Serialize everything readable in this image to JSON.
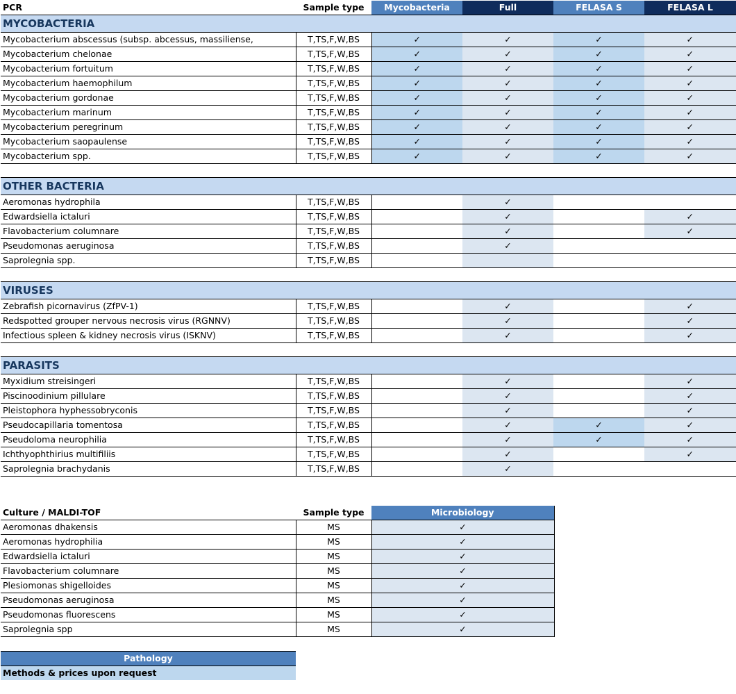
{
  "check_mark": "✓",
  "pcr": {
    "header": {
      "title": "PCR",
      "sample_type": "Sample type",
      "columns": [
        "Mycobacteria",
        "Full",
        "FELASA S",
        "FELASA L"
      ]
    },
    "sections": [
      {
        "title": "MYCOBACTERIA",
        "rows": [
          {
            "name": "Mycobacterium abscessus (subsp. abcessus, massiliense,",
            "sample": "T,TS,F,W,BS",
            "checks": [
              true,
              true,
              true,
              true
            ]
          },
          {
            "name": "Mycobacterium chelonae",
            "sample": "T,TS,F,W,BS",
            "checks": [
              true,
              true,
              true,
              true
            ]
          },
          {
            "name": "Mycobacterium fortuitum",
            "sample": "T,TS,F,W,BS",
            "checks": [
              true,
              true,
              true,
              true
            ]
          },
          {
            "name": "Mycobacterium haemophilum",
            "sample": "T,TS,F,W,BS",
            "checks": [
              true,
              true,
              true,
              true
            ]
          },
          {
            "name": "Mycobacterium gordonae",
            "sample": "T,TS,F,W,BS",
            "checks": [
              true,
              true,
              true,
              true
            ]
          },
          {
            "name": "Mycobacterium marinum",
            "sample": "T,TS,F,W,BS",
            "checks": [
              true,
              true,
              true,
              true
            ]
          },
          {
            "name": "Mycobacterium peregrinum",
            "sample": "T,TS,F,W,BS",
            "checks": [
              true,
              true,
              true,
              true
            ]
          },
          {
            "name": "Mycobacterium saopaulense",
            "sample": "T,TS,F,W,BS",
            "checks": [
              true,
              true,
              true,
              true
            ]
          },
          {
            "name": "Mycobacterium spp.",
            "sample": "T,TS,F,W,BS",
            "checks": [
              true,
              true,
              true,
              true
            ]
          }
        ]
      },
      {
        "title": "OTHER BACTERIA",
        "rows": [
          {
            "name": "Aeromonas hydrophila",
            "sample": "T,TS,F,W,BS",
            "checks": [
              false,
              true,
              false,
              false
            ]
          },
          {
            "name": "Edwardsiella ictaluri",
            "sample": "T,TS,F,W,BS",
            "checks": [
              false,
              true,
              false,
              true
            ]
          },
          {
            "name": "Flavobacterium columnare",
            "sample": "T,TS,F,W,BS",
            "checks": [
              false,
              true,
              false,
              true
            ]
          },
          {
            "name": "Pseudomonas aeruginosa",
            "sample": "T,TS,F,W,BS",
            "checks": [
              false,
              true,
              false,
              false
            ]
          },
          {
            "name": "Saprolegnia spp.",
            "sample": "T,TS,F,W,BS",
            "checks": [
              false,
              false,
              false,
              false
            ]
          }
        ]
      },
      {
        "title": "VIRUSES",
        "rows": [
          {
            "name": "Zebrafish picornavirus (ZfPV-1)",
            "sample": "T,TS,F,W,BS",
            "checks": [
              false,
              true,
              false,
              true
            ]
          },
          {
            "name": "Redspotted grouper nervous necrosis virus (RGNNV)",
            "sample": "T,TS,F,W,BS",
            "checks": [
              false,
              true,
              false,
              true
            ]
          },
          {
            "name": "Infectious spleen & kidney necrosis virus (ISKNV)",
            "sample": "T,TS,F,W,BS",
            "checks": [
              false,
              true,
              false,
              true
            ]
          }
        ]
      },
      {
        "title": "PARASITS",
        "rows": [
          {
            "name": "Myxidium streisingeri",
            "sample": "T,TS,F,W,BS",
            "checks": [
              false,
              true,
              false,
              true
            ]
          },
          {
            "name": "Piscinoodinium pillulare",
            "sample": "T,TS,F,W,BS",
            "checks": [
              false,
              true,
              false,
              true
            ]
          },
          {
            "name": "Pleistophora hyphessobryconis",
            "sample": "T,TS,F,W,BS",
            "checks": [
              false,
              true,
              false,
              true
            ]
          },
          {
            "name": "Pseudocapillaria tomentosa",
            "sample": "T,TS,F,W,BS",
            "checks": [
              false,
              true,
              true,
              true
            ]
          },
          {
            "name": "Pseudoloma neurophilia",
            "sample": "T,TS,F,W,BS",
            "checks": [
              false,
              true,
              true,
              true
            ]
          },
          {
            "name": "Ichthyophthirius multifiliis",
            "sample": "T,TS,F,W,BS",
            "checks": [
              false,
              true,
              false,
              true
            ]
          },
          {
            "name": "Saprolegnia brachydanis",
            "sample": "T,TS,F,W,BS",
            "checks": [
              false,
              true,
              false,
              false
            ]
          }
        ]
      }
    ]
  },
  "culture": {
    "header": {
      "title": "Culture / MALDI-TOF",
      "sample_type": "Sample type",
      "column": "Microbiology"
    },
    "rows": [
      {
        "name": "Aeromonas dhakensis",
        "sample": "MS",
        "check": true
      },
      {
        "name": "Aeromonas hydrophilia",
        "sample": "MS",
        "check": true
      },
      {
        "name": "Edwardsiella ictaluri",
        "sample": "MS",
        "check": true
      },
      {
        "name": "Flavobacterium columnare",
        "sample": "MS",
        "check": true
      },
      {
        "name": "Plesiomonas shigelloides",
        "sample": "MS",
        "check": true
      },
      {
        "name": "Pseudomonas aeruginosa",
        "sample": "MS",
        "check": true
      },
      {
        "name": "Pseudomonas fluorescens",
        "sample": "MS",
        "check": true
      },
      {
        "name": "Saprolegnia spp",
        "sample": "MS",
        "check": true
      }
    ]
  },
  "pathology": {
    "title": "Pathology",
    "note": "Methods & prices upon request"
  }
}
